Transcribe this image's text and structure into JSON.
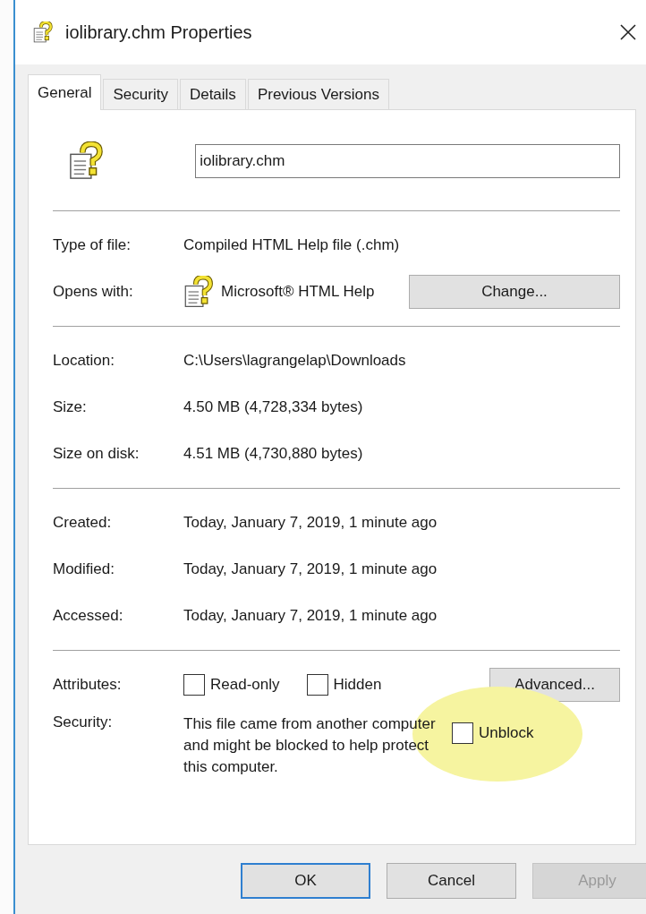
{
  "window": {
    "title": "iolibrary.chm Properties"
  },
  "tabs": [
    {
      "label": "General",
      "selected": true
    },
    {
      "label": "Security",
      "selected": false
    },
    {
      "label": "Details",
      "selected": false
    },
    {
      "label": "Previous Versions",
      "selected": false
    }
  ],
  "file_name": {
    "value": "iolibrary.chm"
  },
  "sections": [
    {
      "rows": [
        {
          "kind": "text",
          "label": "Type of file:",
          "value": "Compiled HTML Help file (.chm)"
        },
        {
          "kind": "app",
          "label": "Opens with:",
          "value": "Microsoft® HTML Help",
          "button": "Change..."
        }
      ]
    },
    {
      "rows": [
        {
          "kind": "text",
          "label": "Location:",
          "value": "C:\\Users\\lagrangelap\\Downloads"
        },
        {
          "kind": "text",
          "label": "Size:",
          "value": "4.50 MB (4,728,334 bytes)"
        },
        {
          "kind": "text",
          "label": "Size on disk:",
          "value": "4.51 MB (4,730,880 bytes)"
        }
      ]
    },
    {
      "rows": [
        {
          "kind": "text",
          "label": "Created:",
          "value": "Today, January 7, 2019, 1 minute ago"
        },
        {
          "kind": "text",
          "label": "Modified:",
          "value": "Today, January 7, 2019, 1 minute ago"
        },
        {
          "kind": "text",
          "label": "Accessed:",
          "value": "Today, January 7, 2019, 1 minute ago"
        }
      ]
    },
    {
      "rows": [
        {
          "kind": "checkboxes",
          "label": "Attributes:",
          "checkboxes": [
            {
              "label": "Read-only",
              "checked": false
            },
            {
              "label": "Hidden",
              "checked": false
            }
          ],
          "button": "Advanced..."
        },
        {
          "kind": "security",
          "label": "Security:",
          "value": "This file came from another computer and might be blocked to help protect this computer.",
          "checkbox": {
            "label": "Unblock",
            "checked": false,
            "highlighted": true
          }
        }
      ]
    }
  ],
  "buttons": [
    {
      "label": "OK",
      "default": true,
      "disabled": false
    },
    {
      "label": "Cancel",
      "default": false,
      "disabled": false
    },
    {
      "label": "Apply",
      "default": false,
      "disabled": true
    }
  ]
}
